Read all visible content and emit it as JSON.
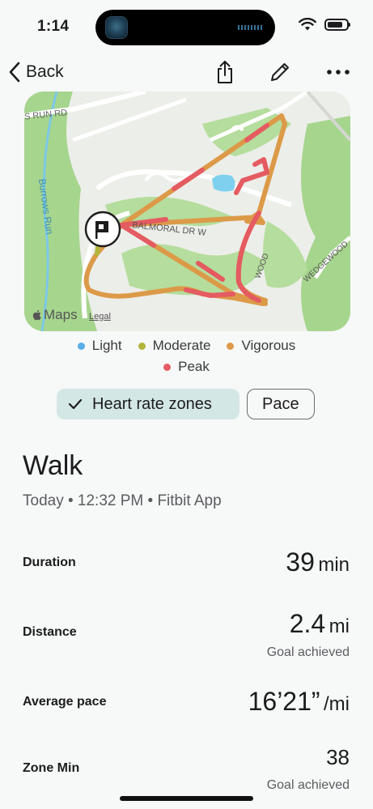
{
  "status_bar": {
    "time": "1:14"
  },
  "nav": {
    "back_label": "Back",
    "icons": [
      "share-icon",
      "pencil-icon",
      "more-icon"
    ]
  },
  "map": {
    "labels": {
      "street_1": "S RUN RD",
      "creek": "Burrows Run",
      "street_2": "BALMORAL DR W",
      "street_3": "WEDGEWOOD",
      "street_4": "WOOD"
    },
    "attribution": "Maps",
    "legal": "Legal"
  },
  "legend": {
    "items": [
      {
        "label": "Light",
        "color": "#5aaee6"
      },
      {
        "label": "Moderate",
        "color": "#b3b53c"
      },
      {
        "label": "Vigorous",
        "color": "#dc9a48"
      },
      {
        "label": "Peak",
        "color": "#e55b62"
      }
    ]
  },
  "toggles": {
    "active": "Heart rate zones",
    "inactive": "Pace"
  },
  "workout": {
    "title": "Walk",
    "subtitle": "Today • 12:32 PM • Fitbit App"
  },
  "stats": {
    "duration": {
      "label": "Duration",
      "value": "39",
      "unit": "min"
    },
    "distance": {
      "label": "Distance",
      "value": "2.4",
      "unit": "mi",
      "goal": "Goal achieved"
    },
    "pace": {
      "label": "Average pace",
      "value": "16’21”",
      "unit": "/mi"
    },
    "zone_min": {
      "label": "Zone Min",
      "value": "38",
      "goal": "Goal achieved"
    }
  }
}
